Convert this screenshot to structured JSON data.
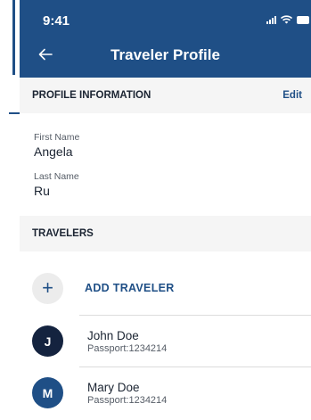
{
  "status_bar": {
    "time": "9:41"
  },
  "header": {
    "title": "Traveler Profile"
  },
  "profile": {
    "section_title": "PROFILE INFORMATION",
    "edit_label": "Edit",
    "first_name_label": "First Name",
    "first_name_value": "Angela",
    "last_name_label": "Last Name",
    "last_name_value": "Ru"
  },
  "travelers": {
    "section_title": "TRAVELERS",
    "add_label": "ADD TRAVELER",
    "add_icon": "+",
    "items": [
      {
        "initial": "J",
        "name": "John Doe",
        "passport": "Passport:1234214",
        "avatar_color": "#14233f"
      },
      {
        "initial": "M",
        "name": "Mary Doe",
        "passport": "Passport:1234214",
        "avatar_color": "#1f4f86"
      }
    ]
  },
  "colors": {
    "brand": "#1f4f86",
    "section_bg": "#f5f5f5"
  }
}
